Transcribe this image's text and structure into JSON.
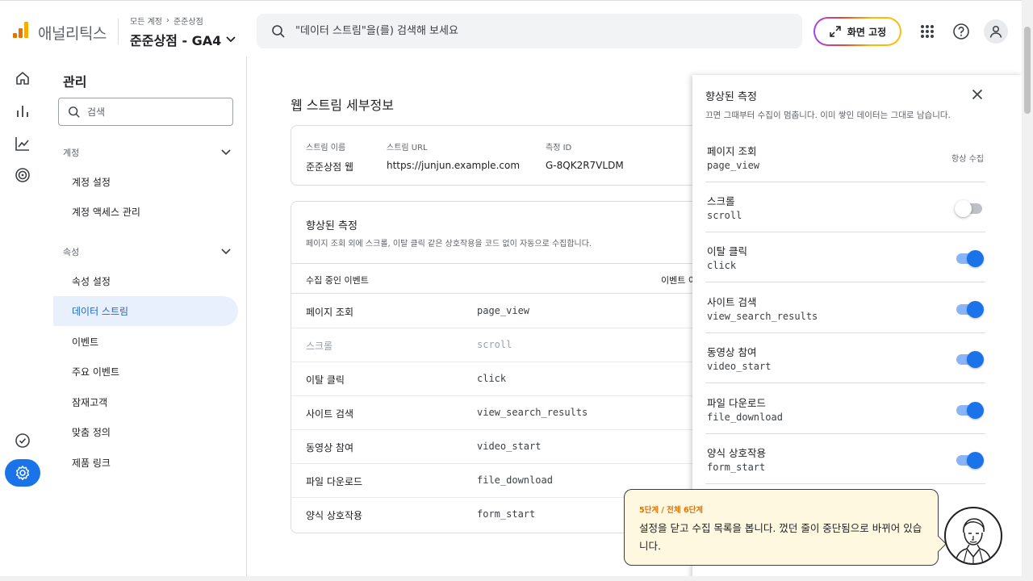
{
  "app": {
    "name": "애널리틱스"
  },
  "header": {
    "breadcrumb": [
      "모든 계정",
      "준준상점"
    ],
    "property_title": "준준상점 - GA4",
    "search_placeholder": "\"데이터 스트림\"을(를) 검색해 보세요",
    "pin_button": "화면 고정"
  },
  "admin_nav": {
    "title": "관리",
    "search_placeholder": "검색",
    "account_section": "계정",
    "account_items": [
      "계정 설정",
      "계정 액세스 관리"
    ],
    "property_section": "속성",
    "property_items": [
      "속성 설정",
      "데이터 스트림",
      "이벤트",
      "주요 이벤트",
      "잠재고객",
      "맞춤 정의",
      "제품 링크"
    ],
    "active_item": "데이터 스트림"
  },
  "main": {
    "title": "웹 스트림 세부정보",
    "stream": {
      "name_label": "스트림 이름",
      "name_value": "준준상점 웹",
      "url_label": "스트림 URL",
      "url_value": "https://junjun.example.com",
      "id_label": "측정 ID",
      "id_value": "G-8QK2R7VLDM"
    },
    "enhanced": {
      "title": "향상된 측정",
      "description": "페이지 조회 외에 스크롤, 이탈 클릭 같은 상호작용을 코드 없이 자동으로 수집합니다.",
      "col_events": "수집 중인 이벤트",
      "col_event_name": "이벤트 이",
      "rows": [
        {
          "name": "페이지 조회",
          "event": "page_view",
          "active": true
        },
        {
          "name": "스크롤",
          "event": "scroll",
          "active": false
        },
        {
          "name": "이탈 클릭",
          "event": "click",
          "active": true
        },
        {
          "name": "사이트 검색",
          "event": "view_search_results",
          "active": true
        },
        {
          "name": "동영상 참여",
          "event": "video_start",
          "active": true
        },
        {
          "name": "파일 다운로드",
          "event": "file_download",
          "active": true
        },
        {
          "name": "양식 상호작용",
          "event": "form_start",
          "active": true
        }
      ]
    }
  },
  "panel": {
    "title": "향상된 측정",
    "description": "끄면 그때부터 수집이 멈춥니다. 이미 쌓인 데이터는 그대로 남습니다.",
    "always_label": "항상 수집",
    "rows": [
      {
        "name": "페이지 조회",
        "event": "page_view",
        "state": "always"
      },
      {
        "name": "스크롤",
        "event": "scroll",
        "state": "off"
      },
      {
        "name": "이탈 클릭",
        "event": "click",
        "state": "on"
      },
      {
        "name": "사이트 검색",
        "event": "view_search_results",
        "state": "on"
      },
      {
        "name": "동영상 참여",
        "event": "video_start",
        "state": "on"
      },
      {
        "name": "파일 다운로드",
        "event": "file_download",
        "state": "on"
      },
      {
        "name": "양식 상호작용",
        "event": "form_start",
        "state": "on"
      }
    ]
  },
  "tutorial": {
    "step": "5단계 / 전체 6단계",
    "message": "설정을 닫고 수집 목록을 봅니다. 껐던 줄이 중단됨으로 바뀌어 있습니다."
  },
  "colors": {
    "accent": "#1a73e8",
    "active_nav_bg": "#e8f0fe",
    "tip_bg": "#fff8e1",
    "step_text": "#e37400"
  },
  "icons": {
    "rail": [
      "home-icon",
      "reports-icon",
      "explore-icon",
      "advertising-icon",
      "configure-icon",
      "admin-gear-icon"
    ],
    "header": [
      "search-icon",
      "expand-icon",
      "apps-grid-icon",
      "help-icon",
      "account-icon"
    ]
  }
}
